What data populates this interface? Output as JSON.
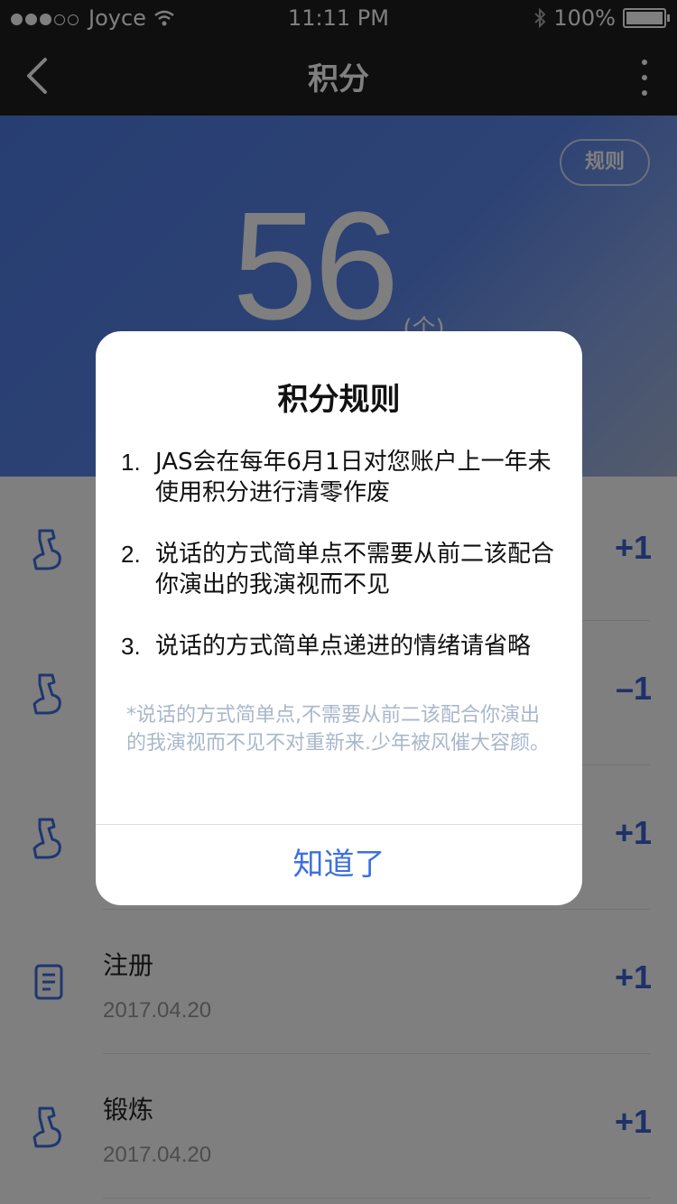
{
  "status_bar": {
    "carrier": "Joyce",
    "time": "11:11 PM",
    "battery": "100%"
  },
  "nav": {
    "title": "积分"
  },
  "hero": {
    "rules_label": "规则",
    "points": "56",
    "unit": "(个)"
  },
  "list": {
    "items": [
      {
        "name": "",
        "date": "",
        "delta": "+1",
        "icon": "arm-icon"
      },
      {
        "name": "",
        "date": "",
        "delta": "–1",
        "icon": "arm-icon"
      },
      {
        "name": "",
        "date": "",
        "delta": "+1",
        "icon": "arm-icon"
      },
      {
        "name": "注册",
        "date": "2017.04.20",
        "delta": "+1",
        "icon": "document-icon"
      },
      {
        "name": "锻炼",
        "date": "2017.04.20",
        "delta": "+1",
        "icon": "arm-icon"
      }
    ]
  },
  "dialog": {
    "title": "积分规则",
    "rules": [
      {
        "num": "1.",
        "text": "JAS会在每年6月1日对您账户上一年未使用积分进行清零作废"
      },
      {
        "num": "2.",
        "text": "说话的方式简单点不需要从前二该配合你演出的我演视而不见"
      },
      {
        "num": "3.",
        "text": "说话的方式简单点递进的情绪请省略"
      }
    ],
    "note": "*说话的方式简单点,不需要从前二该配合你演出的我演视而不见不对重新来.少年被风催大容颜。",
    "confirm": "知道了"
  },
  "colors": {
    "accent": "#3d6fe0",
    "hero_blue": "#5b86ea",
    "nav_bg": "#1e1e1e"
  }
}
